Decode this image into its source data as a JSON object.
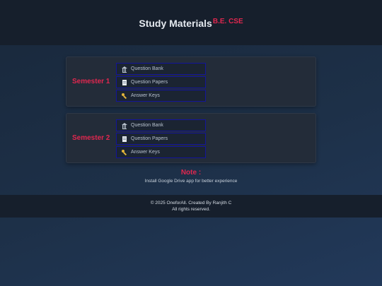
{
  "header": {
    "title": "Study Materials",
    "subtitle": "B.E. CSE"
  },
  "semesters": [
    {
      "label": "Semester 1",
      "links": [
        {
          "label": "Question Bank",
          "icon": "bank-icon"
        },
        {
          "label": "Question Papers",
          "icon": "document-icon"
        },
        {
          "label": "Answer Keys",
          "icon": "key-icon"
        }
      ]
    },
    {
      "label": "Semester 2",
      "links": [
        {
          "label": "Question Bank",
          "icon": "bank-icon"
        },
        {
          "label": "Question Papers",
          "icon": "document-icon"
        },
        {
          "label": "Answer Keys",
          "icon": "key-icon"
        }
      ]
    }
  ],
  "note": {
    "title": "Note :",
    "text": "Install Google Drive app for better experience"
  },
  "footer": {
    "line1": "© 2025 OneforAll. Created By Ranjith C",
    "line2": "All rights reserved."
  },
  "colors": {
    "accent": "#e0274f",
    "link_border": "#13159a",
    "header_bg": "#161f2c"
  }
}
